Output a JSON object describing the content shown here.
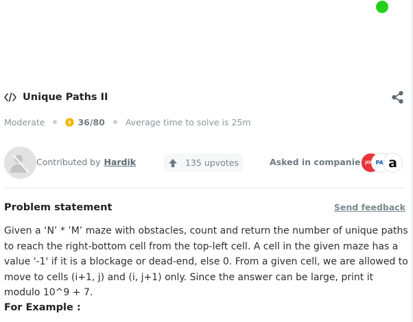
{
  "problem": {
    "title": "Unique Paths II",
    "difficulty": "Moderate",
    "score": "36/80",
    "avg_time": "Average time to solve is 25m"
  },
  "contributor": {
    "label": "Contributed by",
    "name": "Hardik"
  },
  "upvotes": "135 upvotes",
  "companies": {
    "label": "Asked in companies",
    "logos": [
      {
        "icon": "company-logo-red",
        "text": "JOBS",
        "color": "#e8343a"
      },
      {
        "icon": "paytm-style-logo",
        "text": "PAY",
        "color": "#1a5fb4"
      },
      {
        "icon": "amazon-logo",
        "text": "a",
        "color": "#111111"
      }
    ]
  },
  "statement": {
    "heading": "Problem statement",
    "feedback_label": "Send feedback",
    "body": "Given a ‘N’ * ’M’ maze with obstacles, count and return the number of unique paths to reach the right-bottom cell from the top-left cell. A cell in the given maze has a value '-1' if it is a blockage or dead-end, else 0. From a given cell, we are allowed to move to cells (i+1, j) and (i, j+1) only. Since the answer can be large, print it modulo 10^9 + 7.",
    "example_label": "For Example :"
  },
  "colors": {
    "status_dot": "#22d018",
    "muted_text": "#8b959b",
    "score_icon": "#f4b400"
  }
}
